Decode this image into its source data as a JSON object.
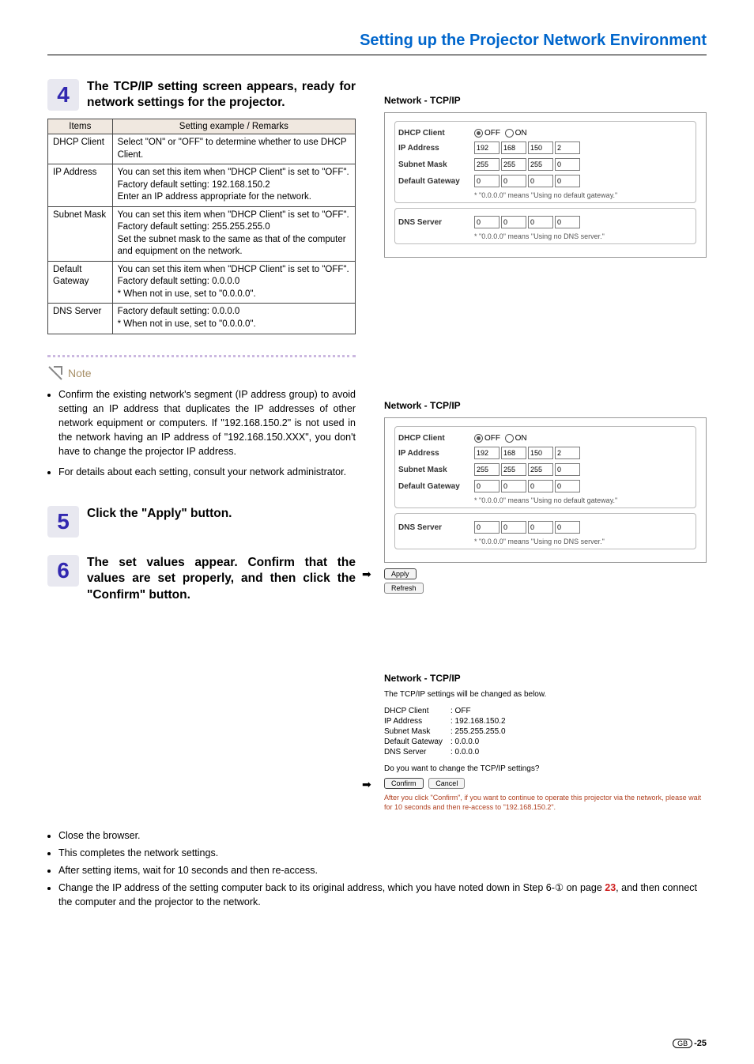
{
  "header": "Setting up the Projector Network Environment",
  "step4": {
    "num": "4",
    "title": "The TCP/IP setting screen appears, ready for network settings for the projector.",
    "table": {
      "h1": "Items",
      "h2": "Setting example / Remarks",
      "rows": [
        {
          "item": "DHCP Client",
          "remark": "Select \"ON\" or \"OFF\" to determine whether to use DHCP Client."
        },
        {
          "item": "IP Address",
          "remark": "You can set this item when \"DHCP Client\" is set to \"OFF\".\nFactory default setting: 192.168.150.2\nEnter an IP address appropriate for the network."
        },
        {
          "item": "Subnet Mask",
          "remark": "You can set this item when \"DHCP Client\" is set to \"OFF\".\nFactory default setting: 255.255.255.0\nSet the subnet mask to the same as that of the computer and equipment on the network."
        },
        {
          "item": "Default Gateway",
          "remark": "You can set this item when \"DHCP Client\" is set to \"OFF\".\nFactory default setting: 0.0.0.0\n* When not in use, set to \"0.0.0.0\"."
        },
        {
          "item": "DNS Server",
          "remark": "Factory default setting: 0.0.0.0\n* When not in use, set to \"0.0.0.0\"."
        }
      ]
    }
  },
  "note": {
    "label": "Note",
    "items": [
      "Confirm the existing network's segment (IP address group) to avoid setting an IP address that duplicates the IP addresses of other network equipment or computers. If \"192.168.150.2\" is not used in the network having an IP address of \"192.168.150.XXX\", you don't have to change the projector IP address.",
      "For details about each setting, consult your network administrator."
    ]
  },
  "step5": {
    "num": "5",
    "title": "Click the \"Apply\" button."
  },
  "step6": {
    "num": "6",
    "title": "The set values appear. Confirm that the values are set properly, and then click the \"Confirm\" button."
  },
  "footer": [
    "Close the browser.",
    "This completes the network settings.",
    "After setting items, wait for 10 seconds and then re-access.",
    "Change the IP address of the setting computer back to its original address, which you have noted down in Step 6-① on page 23, and then connect the computer and the projector to the network."
  ],
  "panel": {
    "title": "Network - TCP/IP",
    "dhcp": {
      "label": "DHCP Client",
      "off": "OFF",
      "on": "ON"
    },
    "ip": {
      "label": "IP Address",
      "v": [
        "192",
        "168",
        "150",
        "2"
      ]
    },
    "mask": {
      "label": "Subnet Mask",
      "v": [
        "255",
        "255",
        "255",
        "0"
      ]
    },
    "gw": {
      "label": "Default Gateway",
      "v": [
        "0",
        "0",
        "0",
        "0"
      ],
      "note": "* \"0.0.0.0\" means \"Using no default gateway.\""
    },
    "dns": {
      "label": "DNS Server",
      "v": [
        "0",
        "0",
        "0",
        "0"
      ],
      "note": "* \"0.0.0.0\" means \"Using no DNS server.\""
    },
    "apply": "Apply",
    "refresh": "Refresh"
  },
  "panel3": {
    "title": "Network - TCP/IP",
    "intro": "The TCP/IP settings will be changed as below.",
    "rows": [
      {
        "l": "DHCP Client",
        "v": ": OFF"
      },
      {
        "l": "IP Address",
        "v": ": 192.168.150.2"
      },
      {
        "l": "Subnet Mask",
        "v": ": 255.255.255.0"
      },
      {
        "l": "Default Gateway",
        "v": ": 0.0.0.0"
      },
      {
        "l": "DNS Server",
        "v": ": 0.0.0.0"
      }
    ],
    "q": "Do you want to change the TCP/IP settings?",
    "confirm": "Confirm",
    "cancel": "Cancel",
    "warn": "After you click \"Confirm\", if you want to continue to operate this projector via the network, please wait for 10 seconds and then re-access to \"192.168.150.2\"."
  },
  "pageNum": "-25",
  "pageNumPrefix": "GB"
}
